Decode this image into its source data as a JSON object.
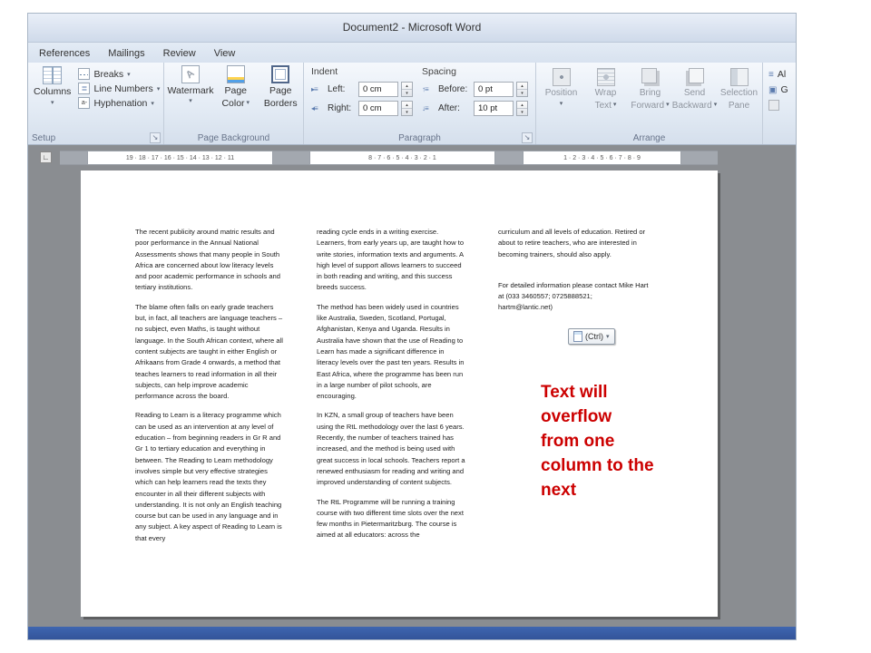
{
  "window": {
    "title": "Document2  -  Microsoft Word"
  },
  "tabs": [
    {
      "label": "References"
    },
    {
      "label": "Mailings"
    },
    {
      "label": "Review"
    },
    {
      "label": "View"
    }
  ],
  "ribbon": {
    "setup": {
      "group_label": "Setup",
      "columns_button": "Columns",
      "breaks": "Breaks",
      "line_numbers": "Line Numbers",
      "hyphenation": "Hyphenation"
    },
    "page_background": {
      "group_label": "Page Background",
      "watermark": "Watermark",
      "page_color_1": "Page",
      "page_color_2": "Color",
      "page_borders_1": "Page",
      "page_borders_2": "Borders"
    },
    "paragraph": {
      "group_label": "Paragraph",
      "indent_label": "Indent",
      "spacing_label": "Spacing",
      "left_label": "Left:",
      "left_value": "0 cm",
      "right_label": "Right:",
      "right_value": "0 cm",
      "before_label": "Before:",
      "before_value": "0 pt",
      "after_label": "After:",
      "after_value": "10 pt"
    },
    "arrange": {
      "group_label": "Arrange",
      "position_1": "Position",
      "wrap_1": "Wrap",
      "wrap_2": "Text",
      "bring_1": "Bring",
      "bring_2": "Forward",
      "send_1": "Send",
      "send_2": "Backward",
      "selection_1": "Selection",
      "selection_2": "Pane"
    },
    "clipped": {
      "align": "Al",
      "group": "G"
    }
  },
  "ruler": {
    "segment1": "19 · 18 · 17 · 16 · 15 · 14 · 13 · 12 · 11",
    "segment2": "8 · 7 · 6 · 5 · 4 · 3 · 2 · 1",
    "segment3": "1 · 2 · 3 · 4 · 5 · 6 · 7 · 8 · 9"
  },
  "document": {
    "column1": {
      "p1": "The recent publicity around matric results and poor performance in the Annual National Assessments shows that many people in South Africa are concerned about low literacy levels and poor academic performance in schools and tertiary institutions.",
      "p2": "The blame often falls on early grade teachers but, in fact, all teachers are language teachers – no subject, even Maths, is taught without language.  In the South African context, where all content subjects are taught in either English or Afrikaans from Grade 4 onwards, a method that teaches learners to read information in all their subjects, can help improve academic performance across the board.",
      "p3": "Reading to Learn is a literacy programme which can be used as an intervention at any level of education – from beginning readers in Gr R and Gr 1 to tertiary education and everything in between.  The Reading to Learn methodology involves simple but very effective strategies which can help learners read the texts they encounter in all their different subjects with understanding.  It is not only an English teaching course but can be used in any language and in any subject.  A key aspect of Reading to Learn is that every"
    },
    "column2": {
      "p1": "reading cycle ends in a writing exercise. Learners, from early years up, are taught how to write stories, information texts and arguments.  A high level of support allows learners to succeed in both reading and writing, and this success breeds success.",
      "p2": "The method has been widely used in countries like Australia, Sweden, Scotland, Portugal, Afghanistan, Kenya and Uganda.  Results in Australia have shown that the use of Reading to Learn has made a significant difference in literacy levels over the past ten years.  Results in East Africa, where the programme has been run in a large number of pilot schools, are encouraging.",
      "p3": "In KZN, a small group of teachers have been using the RtL methodology over the last 6 years.  Recently, the number of teachers trained has increased, and the method is being used with great success in local schools. Teachers report a renewed enthusiasm for reading and writing and improved understanding of content subjects.",
      "p4": "The RtL Programme will be running a training course with two different time slots over the next few months in Pietermaritzburg. The course is aimed at all educators: across the"
    },
    "column3": {
      "p1": "curriculum and all levels of education.  Retired or about to retire teachers, who are interested in becoming trainers, should also apply.",
      "p2": "For detailed information please contact Mike Hart at (033 3460557; 0725888521; hartm@lantic.net)"
    },
    "paste_options_label": "(Ctrl)"
  },
  "annotation": {
    "text": "Text will\noverflow\nfrom one\ncolumn to the\nnext"
  },
  "icons": {
    "dropdown": "▾",
    "spin_up": "▴",
    "spin_down": "▾",
    "dialog_launcher": "↘",
    "indent_left": "▸≡",
    "indent_right": "◂≡",
    "spacing_before": "↑≡",
    "spacing_after": "↓≡",
    "line_numbers": "≣",
    "hyphenation": "a-",
    "watermark_letter": "A",
    "tab_selector": "∟",
    "align_lines": "≡",
    "group_glyph": "▣"
  },
  "colors": {
    "annotation_red": "#cc0000",
    "statusbar_blue": "#3f66b0",
    "workspace_gray": "#8a8d91"
  }
}
